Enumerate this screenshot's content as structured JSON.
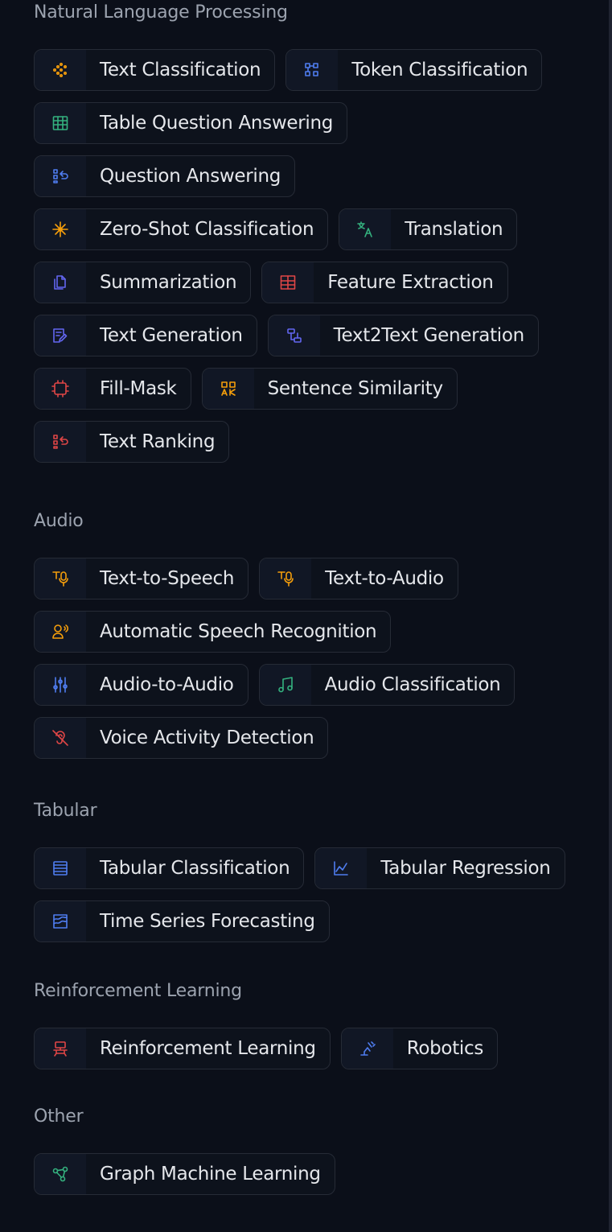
{
  "colors": {
    "background": "#0b0f19",
    "chip_border": "#262b36",
    "section_title": "#9ca3af",
    "label": "#e5e7eb",
    "orange": "#f59e0b",
    "blue": "#4f7df0",
    "green": "#34b27f",
    "red": "#e04646",
    "indigo": "#6366f1"
  },
  "sections": [
    {
      "title": "Natural Language Processing",
      "tasks": [
        {
          "label": "Text Classification",
          "icon": "text-classification-icon",
          "color": "orange"
        },
        {
          "label": "Token Classification",
          "icon": "token-classification-icon",
          "color": "blue"
        },
        {
          "label": "Table Question Answering",
          "icon": "table-icon",
          "color": "green"
        },
        {
          "label": "Question Answering",
          "icon": "question-answering-icon",
          "color": "blue"
        },
        {
          "label": "Zero-Shot Classification",
          "icon": "zero-shot-icon",
          "color": "orange"
        },
        {
          "label": "Translation",
          "icon": "translation-icon",
          "color": "green"
        },
        {
          "label": "Summarization",
          "icon": "summarization-icon",
          "color": "indigo"
        },
        {
          "label": "Feature Extraction",
          "icon": "feature-extraction-icon",
          "color": "red"
        },
        {
          "label": "Text Generation",
          "icon": "text-generation-icon",
          "color": "indigo"
        },
        {
          "label": "Text2Text Generation",
          "icon": "text2text-icon",
          "color": "indigo"
        },
        {
          "label": "Fill-Mask",
          "icon": "fill-mask-icon",
          "color": "red"
        },
        {
          "label": "Sentence Similarity",
          "icon": "sentence-similarity-icon",
          "color": "orange"
        },
        {
          "label": "Text Ranking",
          "icon": "text-ranking-icon",
          "color": "red"
        }
      ]
    },
    {
      "title": "Audio",
      "tasks": [
        {
          "label": "Text-to-Speech",
          "icon": "text-to-speech-icon",
          "color": "orange"
        },
        {
          "label": "Text-to-Audio",
          "icon": "text-to-audio-icon",
          "color": "orange"
        },
        {
          "label": "Automatic Speech Recognition",
          "icon": "speech-recognition-icon",
          "color": "orange"
        },
        {
          "label": "Audio-to-Audio",
          "icon": "audio-to-audio-icon",
          "color": "blue"
        },
        {
          "label": "Audio Classification",
          "icon": "music-note-icon",
          "color": "green"
        },
        {
          "label": "Voice Activity Detection",
          "icon": "ear-icon",
          "color": "red"
        }
      ]
    },
    {
      "title": "Tabular",
      "tasks": [
        {
          "label": "Tabular Classification",
          "icon": "tabular-classification-icon",
          "color": "blue"
        },
        {
          "label": "Tabular Regression",
          "icon": "line-chart-icon",
          "color": "blue"
        },
        {
          "label": "Time Series Forecasting",
          "icon": "time-series-icon",
          "color": "blue"
        }
      ]
    },
    {
      "title": "Reinforcement Learning",
      "tasks": [
        {
          "label": "Reinforcement Learning",
          "icon": "robot-icon",
          "color": "red"
        },
        {
          "label": "Robotics",
          "icon": "robotic-arm-icon",
          "color": "blue"
        }
      ]
    },
    {
      "title": "Other",
      "tasks": [
        {
          "label": "Graph Machine Learning",
          "icon": "graph-icon",
          "color": "green"
        }
      ]
    }
  ]
}
